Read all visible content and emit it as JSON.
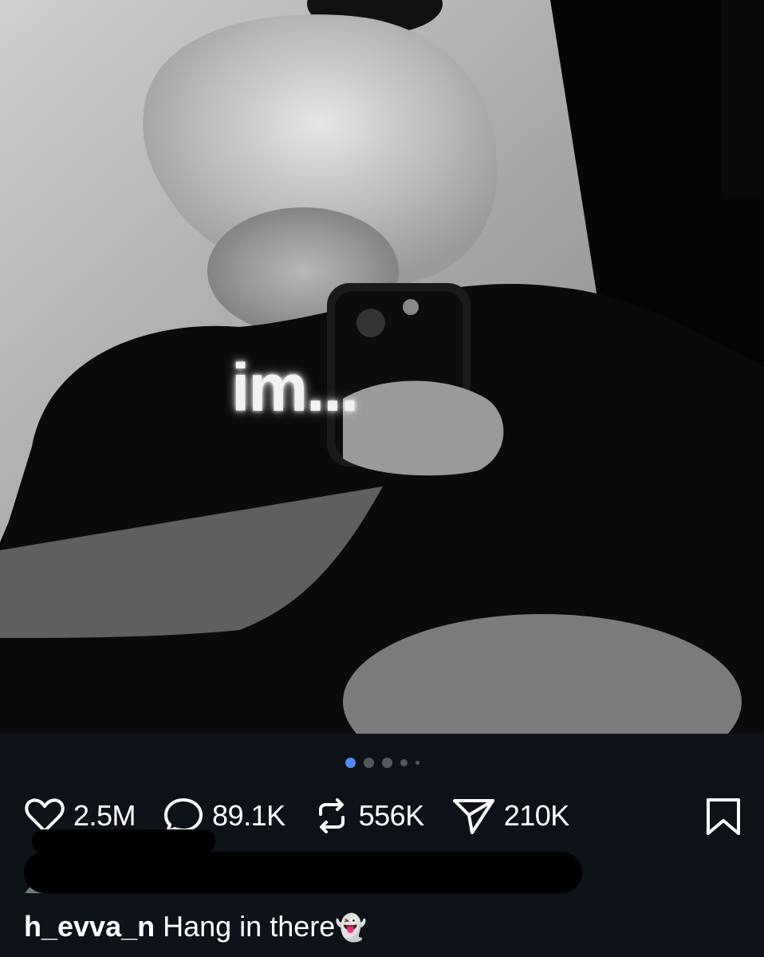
{
  "post": {
    "image": {
      "overlay_text": "im..."
    },
    "carousel": {
      "total": 5,
      "active_index": 0
    },
    "stats": {
      "likes": "2.5M",
      "comments": "89.1K",
      "reposts": "556K",
      "shares": "210K"
    },
    "caption": {
      "username": "h_evva_n",
      "text": "Hang in there",
      "emoji": "👻"
    }
  },
  "icons": [
    "heart-icon",
    "comment-icon",
    "repost-icon",
    "send-icon",
    "bookmark-icon"
  ],
  "colors": {
    "background": "#0d1218",
    "active_dot": "#4f8cf7",
    "inactive_dot": "#55595f",
    "text": "#ffffff"
  }
}
